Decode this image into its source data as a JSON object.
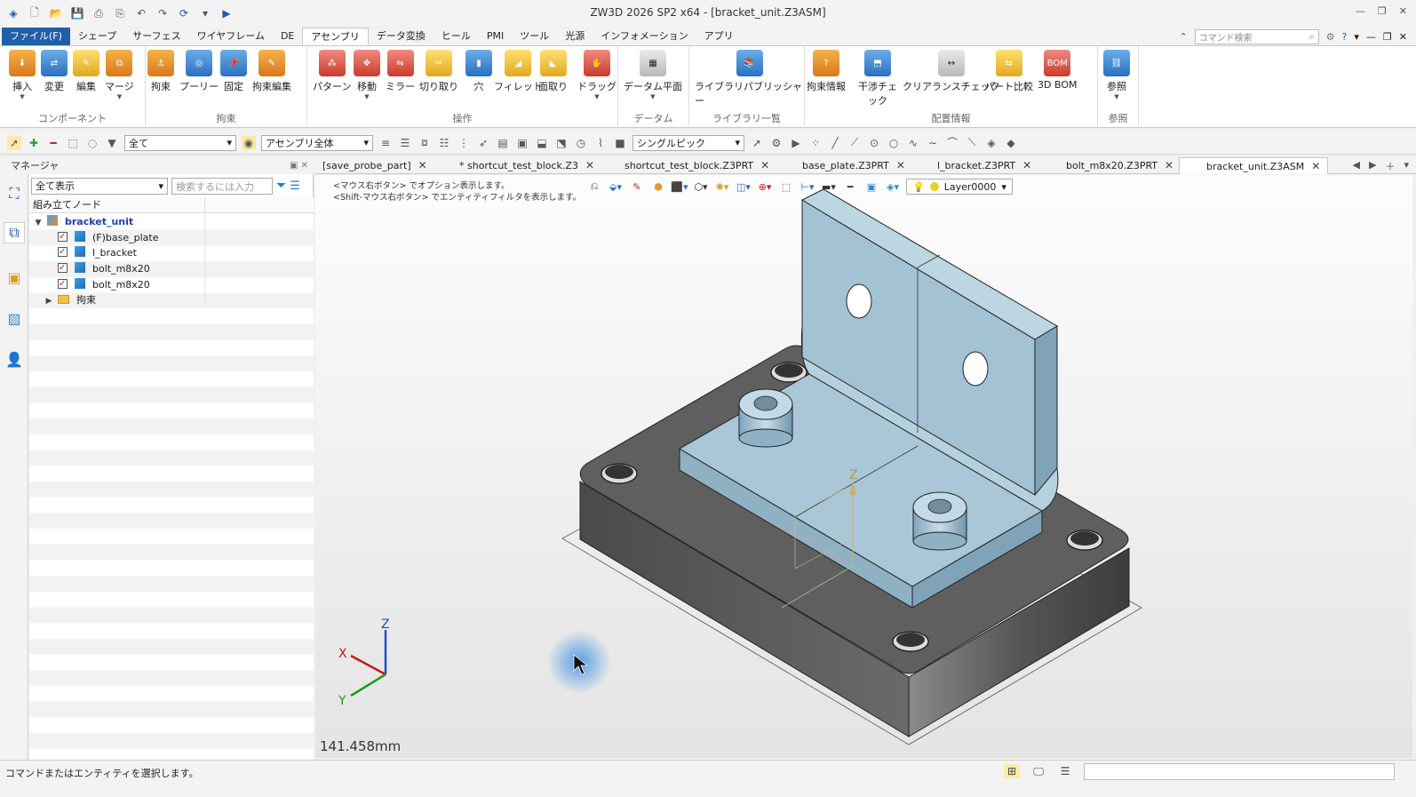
{
  "window": {
    "title": "ZW3D 2026 SP2 x64 - [bracket_unit.Z3ASM]"
  },
  "menu": {
    "tabs": [
      "ファイル(F)",
      "シェープ",
      "サーフェス",
      "ワイヤフレーム",
      "DE",
      "アセンブリ",
      "データ変換",
      "ヒール",
      "PMI",
      "ツール",
      "光源",
      "インフォメーション",
      "アプリ"
    ],
    "active": "アセンブリ",
    "search_placeholder": "コマンド検索"
  },
  "ribbon": {
    "groups": [
      {
        "label": "コンポーネント",
        "buttons": [
          "挿入",
          "変更",
          "編集",
          "マージ"
        ]
      },
      {
        "label": "拘束",
        "buttons": [
          "拘束",
          "プーリー",
          "固定",
          "拘束編集"
        ]
      },
      {
        "label": "操作",
        "buttons": [
          "パターン",
          "移動",
          "ミラー",
          "切り取り",
          "穴",
          "フィレット",
          "面取り",
          "ドラッグ"
        ]
      },
      {
        "label": "データム",
        "buttons": [
          "データム平面"
        ]
      },
      {
        "label": "ライブラリ一覧",
        "buttons": [
          "ライブラリパブリッシャー"
        ]
      },
      {
        "label": "配置情報",
        "buttons": [
          "拘束情報",
          "干渉チェック",
          "クリアランスチェック",
          "パート比較",
          "3D BOM"
        ]
      },
      {
        "label": "参照",
        "buttons": [
          "参照"
        ]
      }
    ]
  },
  "toolbar": {
    "filter_value": "全て",
    "scope_value": "アセンブリ全体",
    "pick_value": "シングルピック"
  },
  "manager": {
    "title": "マネージャ",
    "filter_value": "全て表示",
    "search_placeholder": "検索するには入力し...",
    "tree_header": "組み立てノード",
    "root": "bracket_unit",
    "items": [
      {
        "label": "(F)base_plate"
      },
      {
        "label": "l_bracket"
      },
      {
        "label": "bolt_m8x20"
      },
      {
        "label": "bolt_m8x20"
      }
    ],
    "folder": "拘束"
  },
  "doc_tabs": [
    {
      "label": "[save_probe_part]"
    },
    {
      "label": "* shortcut_test_block.Z3"
    },
    {
      "label": "shortcut_test_block.Z3PRT"
    },
    {
      "label": "base_plate.Z3PRT"
    },
    {
      "label": "l_bracket.Z3PRT"
    },
    {
      "label": "bolt_m8x20.Z3PRT"
    },
    {
      "label": "bracket_unit.Z3ASM"
    }
  ],
  "viewport": {
    "hint1": "<マウス右ボタン> でオプション表示します。",
    "hint2": "<Shift-マウス右ボタン> でエンティティフィルタを表示します。",
    "layer": "Layer0000",
    "scale": "141.458mm",
    "axis_x": "X",
    "axis_y": "Y",
    "axis_z": "Z",
    "origin_z": "Z"
  },
  "status": {
    "text": "コマンドまたはエンティティを選択します。"
  },
  "colors": {
    "accent": "#1f5fa8",
    "part_blue": "#a9c7d6",
    "base_dark": "#5c5c5c"
  }
}
